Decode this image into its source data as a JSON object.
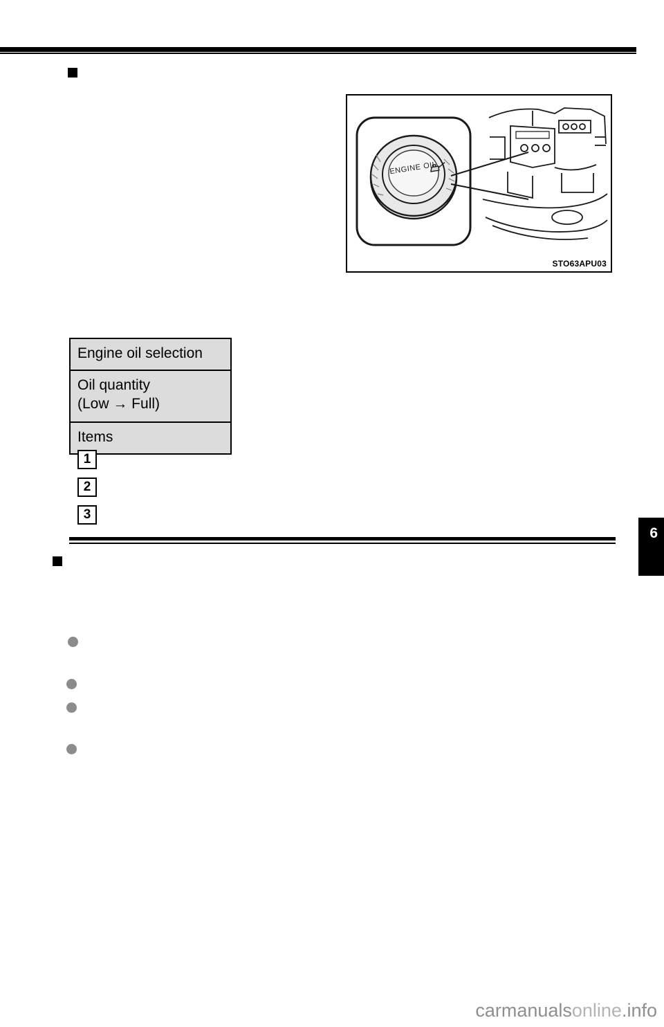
{
  "page": {
    "side_tab_number": "6",
    "footer_text_1": "carmanuals",
    "footer_text_2": "online",
    "footer_text_3": ".info"
  },
  "illustration": {
    "code": "STO63APU03",
    "cap_label": "ENGINE OIL",
    "alt": "engine compartment with oil filler cap callout"
  },
  "table": {
    "rows": [
      {
        "id": "engine-oil-selection",
        "label": "Engine oil selection"
      },
      {
        "id": "oil-quantity",
        "label": "Oil quantity\n(Low → Full)"
      },
      {
        "id": "items",
        "label": "Items"
      }
    ]
  },
  "numbered_items": [
    {
      "number": "1"
    },
    {
      "number": "2"
    },
    {
      "number": "3"
    }
  ],
  "section_markers": [
    {
      "id": "section-marker-top"
    },
    {
      "id": "section-marker-bottom"
    }
  ],
  "bullets": [
    {
      "id": "bullet-1"
    },
    {
      "id": "bullet-2"
    },
    {
      "id": "bullet-3"
    },
    {
      "id": "bullet-4"
    }
  ]
}
